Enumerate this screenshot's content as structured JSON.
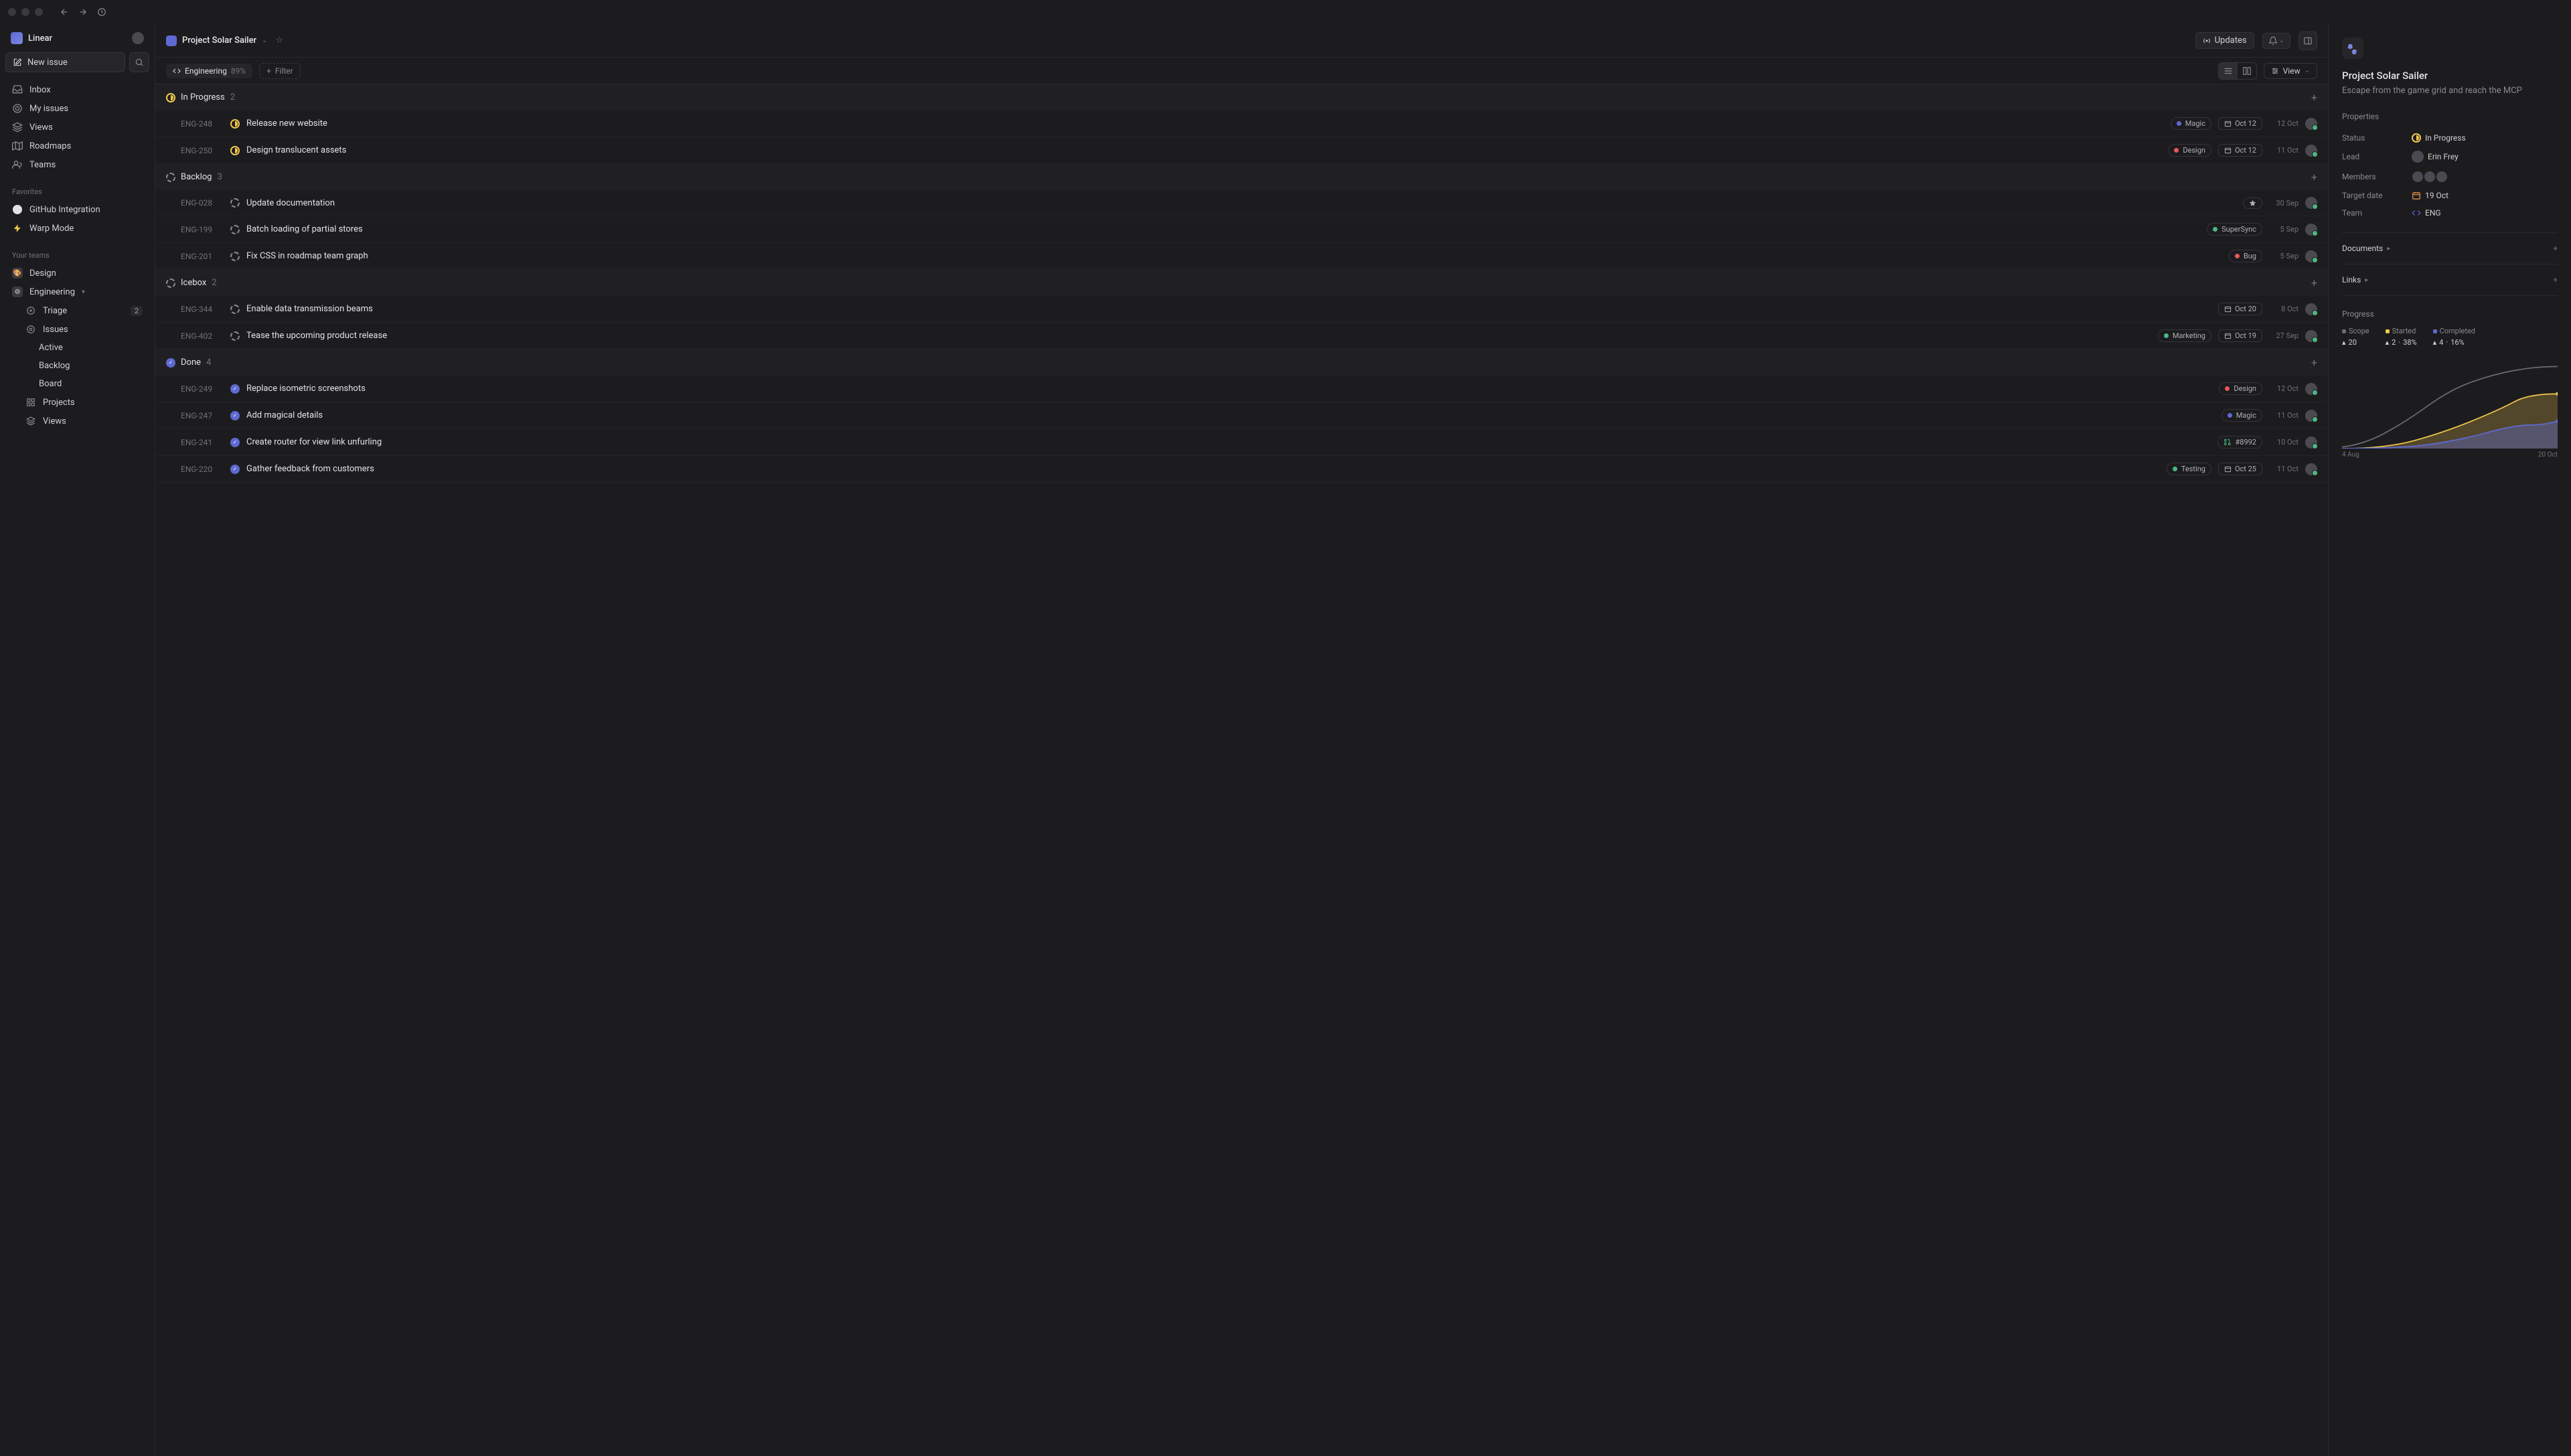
{
  "workspace": {
    "name": "Linear"
  },
  "newIssue": "New issue",
  "nav": {
    "inbox": "Inbox",
    "myIssues": "My issues",
    "views": "Views",
    "roadmaps": "Roadmaps",
    "teams": "Teams"
  },
  "favorites": {
    "label": "Favorites",
    "items": [
      {
        "label": "GitHub Integration"
      },
      {
        "label": "Warp Mode"
      }
    ]
  },
  "yourTeams": {
    "label": "Your teams",
    "items": [
      {
        "label": "Design"
      },
      {
        "label": "Engineering",
        "children": [
          {
            "label": "Triage",
            "badge": "2"
          },
          {
            "label": "Issues",
            "children": [
              {
                "label": "Active"
              },
              {
                "label": "Backlog"
              },
              {
                "label": "Board"
              }
            ]
          },
          {
            "label": "Projects"
          },
          {
            "label": "Views"
          }
        ]
      }
    ]
  },
  "header": {
    "projectTitle": "Project Solar Sailer",
    "updates": "Updates"
  },
  "filterBar": {
    "chipLabel": "Engineering",
    "chipPct": "89%",
    "filter": "Filter",
    "view": "View"
  },
  "groups": [
    {
      "name": "In Progress",
      "count": "2",
      "status": "progress",
      "issues": [
        {
          "id": "ENG-248",
          "title": "Release new website",
          "tag": {
            "label": "Magic",
            "color": "#5e6ad2"
          },
          "dateChip": "Oct 12",
          "date": "12 Oct"
        },
        {
          "id": "ENG-250",
          "title": "Design translucent assets",
          "tag": {
            "label": "Design",
            "color": "#eb5757"
          },
          "dateChip": "Oct 12",
          "date": "11 Oct"
        }
      ]
    },
    {
      "name": "Backlog",
      "count": "3",
      "status": "backlog",
      "issues": [
        {
          "id": "ENG-028",
          "title": "Update documentation",
          "milestone": true,
          "date": "30 Sep"
        },
        {
          "id": "ENG-199",
          "title": "Batch loading of partial stores",
          "tag": {
            "label": "SuperSync",
            "color": "#4cb782"
          },
          "date": "5 Sep"
        },
        {
          "id": "ENG-201",
          "title": "Fix CSS in roadmap team graph",
          "tag": {
            "label": "Bug",
            "color": "#eb5757"
          },
          "date": "5 Sep"
        }
      ]
    },
    {
      "name": "Icebox",
      "count": "2",
      "status": "backlog",
      "issues": [
        {
          "id": "ENG-344",
          "title": "Enable data transmission beams",
          "dateChip": "Oct 20",
          "date": "8 Oct"
        },
        {
          "id": "ENG-402",
          "title": "Tease the upcoming product release",
          "tag": {
            "label": "Marketing",
            "color": "#4cb782"
          },
          "dateChip": "Oct 19",
          "date": "27 Sep"
        }
      ]
    },
    {
      "name": "Done",
      "count": "4",
      "status": "done",
      "issues": [
        {
          "id": "ENG-249",
          "title": "Replace isometric screenshots",
          "tag": {
            "label": "Design",
            "color": "#eb5757"
          },
          "date": "12 Oct"
        },
        {
          "id": "ENG-247",
          "title": "Add magical details",
          "tag": {
            "label": "Magic",
            "color": "#5e6ad2"
          },
          "date": "11 Oct"
        },
        {
          "id": "ENG-241",
          "title": "Create router for view link unfurling",
          "tag": {
            "label": "#8992",
            "pr": true
          },
          "date": "10 Oct"
        },
        {
          "id": "ENG-220",
          "title": "Gather feedback from customers",
          "tag": {
            "label": "Testing",
            "color": "#4cb782"
          },
          "dateChip": "Oct 25",
          "date": "11 Oct"
        }
      ]
    }
  ],
  "details": {
    "title": "Project Solar Sailer",
    "description": "Escape from the game grid and reach the MCP",
    "propertiesTitle": "Properties",
    "props": {
      "statusLabel": "Status",
      "statusValue": "In Progress",
      "leadLabel": "Lead",
      "leadValue": "Erin Frey",
      "membersLabel": "Members",
      "targetLabel": "Target date",
      "targetValue": "19 Oct",
      "teamLabel": "Team",
      "teamValue": "ENG"
    },
    "documents": "Documents",
    "links": "Links",
    "progressTitle": "Progress",
    "stats": {
      "scope": {
        "label": "Scope",
        "value": "20"
      },
      "started": {
        "label": "Started",
        "value": "2",
        "pct": "38%"
      },
      "completed": {
        "label": "Completed",
        "value": "4",
        "pct": "16%"
      }
    },
    "chartStart": "4 Aug",
    "chartEnd": "20 Oct"
  },
  "chart_data": {
    "type": "area",
    "x_range": [
      "4 Aug",
      "20 Oct"
    ],
    "series": [
      {
        "name": "Scope",
        "color": "#6a6a72",
        "values": [
          2,
          4,
          6,
          8,
          10,
          12,
          14,
          16,
          18,
          19,
          20,
          20
        ]
      },
      {
        "name": "Started",
        "color": "#f2c94c",
        "values": [
          0,
          0,
          1,
          1,
          2,
          3,
          4,
          5,
          6,
          7,
          7,
          8
        ]
      },
      {
        "name": "Completed",
        "color": "#5e6ad2",
        "values": [
          0,
          0,
          0,
          0,
          1,
          1,
          2,
          2,
          3,
          3,
          3,
          4
        ]
      }
    ]
  }
}
